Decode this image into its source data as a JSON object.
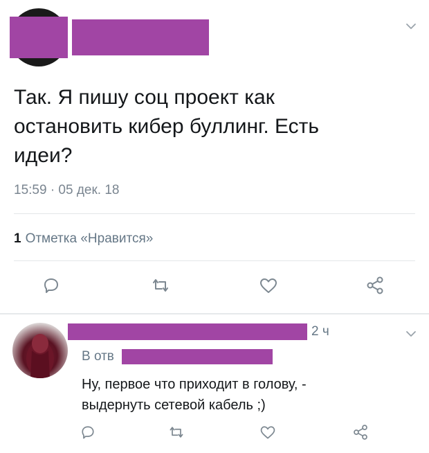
{
  "tweet": {
    "text": "Так. Я пишу соц проект как\nостановить кибер буллинг. Есть\nидеи?",
    "timestamp": "15:59 · 05 дек. 18",
    "likes_count": "1",
    "likes_label": "Отметка «Нравится»",
    "menu_icon": "chevron-down-icon"
  },
  "actions": [
    "reply-icon",
    "retweet-icon",
    "like-icon",
    "share-icon"
  ],
  "reply": {
    "time": "2 ч",
    "reply_to_prefix": "В отв",
    "text": "Ну, первое что приходит в голову, -\nвыдернуть сетевой кабель ;)"
  },
  "colors": {
    "redaction": "#a145a4",
    "icon_gray": "#7d8891",
    "meta_gray": "#657786"
  }
}
